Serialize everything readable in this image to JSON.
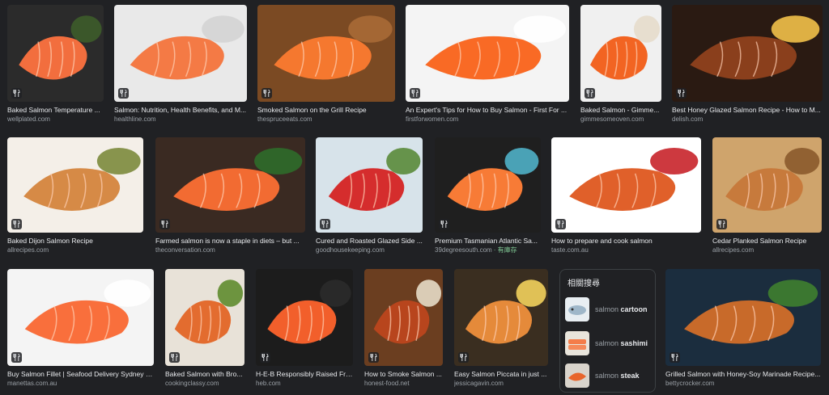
{
  "results": [
    {
      "title": "Baked Salmon Temperature ...",
      "source": "wellplated.com",
      "palette": [
        "#2b2b2b",
        "#f26e3e",
        "#3d5c2a"
      ]
    },
    {
      "title": "Salmon: Nutrition, Health Benefits, and M...",
      "source": "healthline.com",
      "palette": [
        "#e9e9e9",
        "#f47a45",
        "#d4d4d4"
      ]
    },
    {
      "title": "Smoked Salmon on the Grill Recipe",
      "source": "thespruceeats.com",
      "palette": [
        "#7b4a23",
        "#f5782f",
        "#a86a36"
      ]
    },
    {
      "title": "An Expert's Tips for How to Buy Salmon - First For ...",
      "source": "firstforwomen.com",
      "palette": [
        "#f4f4f4",
        "#f96a25",
        "#ffffff"
      ]
    },
    {
      "title": "Baked Salmon - Gimme...",
      "source": "gimmesomeoven.com",
      "palette": [
        "#f0f0f0",
        "#f26422",
        "#e6dccb"
      ]
    },
    {
      "title": "Best Honey Glazed Salmon Recipe - How to M...",
      "source": "delish.com",
      "palette": [
        "#2a1a12",
        "#8a3f1c",
        "#f2c14a"
      ]
    },
    {
      "title": "Baked Dijon Salmon Recipe",
      "source": "allrecipes.com",
      "palette": [
        "#f4efe8",
        "#d68a46",
        "#7c8a3c"
      ]
    },
    {
      "title": "Farmed salmon is now a staple in diets – but ...",
      "source": "theconversation.com",
      "palette": [
        "#3a2a22",
        "#f26b32",
        "#2f6b2a"
      ]
    },
    {
      "title": "Cured and Roasted Glazed Side ...",
      "source": "goodhousekeeping.com",
      "palette": [
        "#d7e3ea",
        "#d52d2d",
        "#5a8a3a"
      ]
    },
    {
      "title": "Premium Tasmanian Atlantic Sa...",
      "source": "39degreesouth.com",
      "tag": "· 有庫存",
      "palette": [
        "#1f1f1f",
        "#f77b36",
        "#4fb0c6"
      ]
    },
    {
      "title": "How to prepare and cook salmon",
      "source": "taste.com.au",
      "palette": [
        "#ffffff",
        "#e0602a",
        "#c8242a"
      ]
    },
    {
      "title": "Cedar Planked Salmon Recipe",
      "source": "allrecipes.com",
      "palette": [
        "#cfa46c",
        "#c77a3c",
        "#8a5a2c"
      ]
    },
    {
      "title": "Buy Salmon Fillet | Seafood Delivery Sydney | ...",
      "source": "manettas.com.au",
      "palette": [
        "#f4f4f4",
        "#f96f3c",
        "#ffffff"
      ]
    },
    {
      "title": "Baked Salmon with Bro...",
      "source": "cookingclassy.com",
      "palette": [
        "#e8e2d8",
        "#e36c2f",
        "#5f8c2f"
      ]
    },
    {
      "title": "H-E-B Responsibly Raised Fre...",
      "source": "heb.com",
      "palette": [
        "#1c1c1c",
        "#f25f2b",
        "#2b2b2b"
      ]
    },
    {
      "title": "How to Smoke Salmon ...",
      "source": "honest-food.net",
      "palette": [
        "#6b3e20",
        "#b8451d",
        "#e7dcc6"
      ]
    },
    {
      "title": "Easy Salmon Piccata in just ...",
      "source": "jessicagavin.com",
      "palette": [
        "#3a2e20",
        "#e58a3a",
        "#f3d25c"
      ]
    },
    {
      "title": "Grilled Salmon with Honey-Soy Marinade Recipe...",
      "source": "bettycrocker.com",
      "palette": [
        "#1b2d3e",
        "#c86a2a",
        "#3f7f2f"
      ]
    }
  ],
  "related": {
    "title": "相關搜尋",
    "items": [
      {
        "prefix": "salmon",
        "term": "cartoon"
      },
      {
        "prefix": "salmon",
        "term": "sashimi"
      },
      {
        "prefix": "salmon",
        "term": "steak"
      }
    ]
  },
  "colors": {
    "background": "#202124",
    "text": "#e8eaed",
    "muted": "#9aa0a6",
    "accent_tag": "#81c995"
  },
  "icons": {
    "result_badge": "recipe-icon"
  }
}
